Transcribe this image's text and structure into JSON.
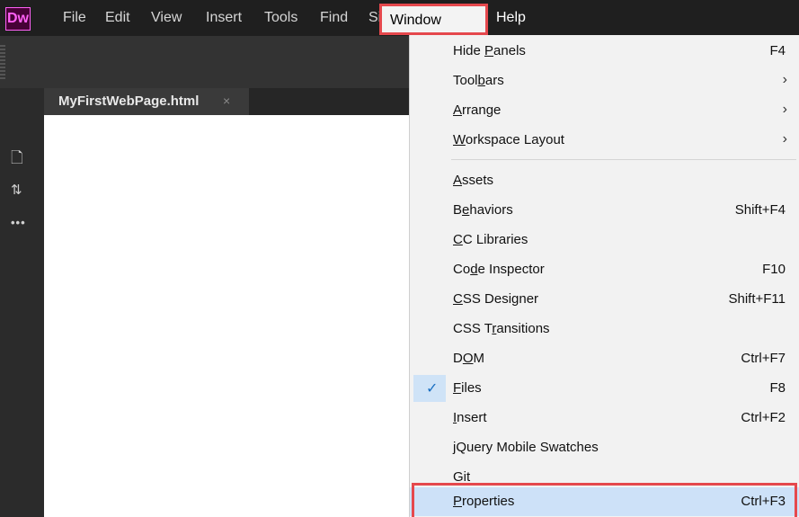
{
  "app": {
    "logo_text": "Dw"
  },
  "menubar": {
    "items": [
      "File",
      "Edit",
      "View",
      "Insert",
      "Tools",
      "Find",
      "Site"
    ],
    "window_label": "Window",
    "help_label": "Help"
  },
  "document": {
    "tab_name": "MyFirstWebPage.html",
    "tab_close": "×"
  },
  "left_panel": {
    "icons": [
      "new-file-icon",
      "transfer-icon",
      "more-icon"
    ],
    "more_glyph": "•••"
  },
  "window_menu": {
    "items": [
      {
        "label": "Hide Panels",
        "ul": 5,
        "shortcut": "F4"
      },
      {
        "label": "Toolbars",
        "ul": 4,
        "submenu": true
      },
      {
        "label": "Arrange",
        "ul": 0,
        "submenu": true
      },
      {
        "label": "Workspace Layout",
        "ul": 0,
        "submenu": true
      },
      {
        "label": "Assets",
        "ul": 0
      },
      {
        "label": "Behaviors",
        "ul": 1,
        "shortcut": "Shift+F4"
      },
      {
        "label": "CC Libraries",
        "ul": 0
      },
      {
        "label": "Code Inspector",
        "ul": 2,
        "shortcut": "F10"
      },
      {
        "label": "CSS Designer",
        "ul": 0,
        "shortcut": "Shift+F11"
      },
      {
        "label": "CSS Transitions",
        "ul": 5
      },
      {
        "label": "DOM",
        "ul": 1,
        "shortcut": "Ctrl+F7"
      },
      {
        "label": "Files",
        "ul": 0,
        "shortcut": "F8",
        "checked": true
      },
      {
        "label": "Insert",
        "ul": 0,
        "shortcut": "Ctrl+F2"
      },
      {
        "label": "jQuery Mobile Swatches"
      },
      {
        "label": "Git"
      },
      {
        "label": "Properties",
        "ul": 0,
        "shortcut": "Ctrl+F3",
        "highlighted": true
      }
    ],
    "submenu_arrow": "›",
    "check_glyph": "✓"
  },
  "colors": {
    "accent_outline": "#e5484d",
    "highlight": "#cde1f8",
    "logo": "#ff61f6"
  }
}
